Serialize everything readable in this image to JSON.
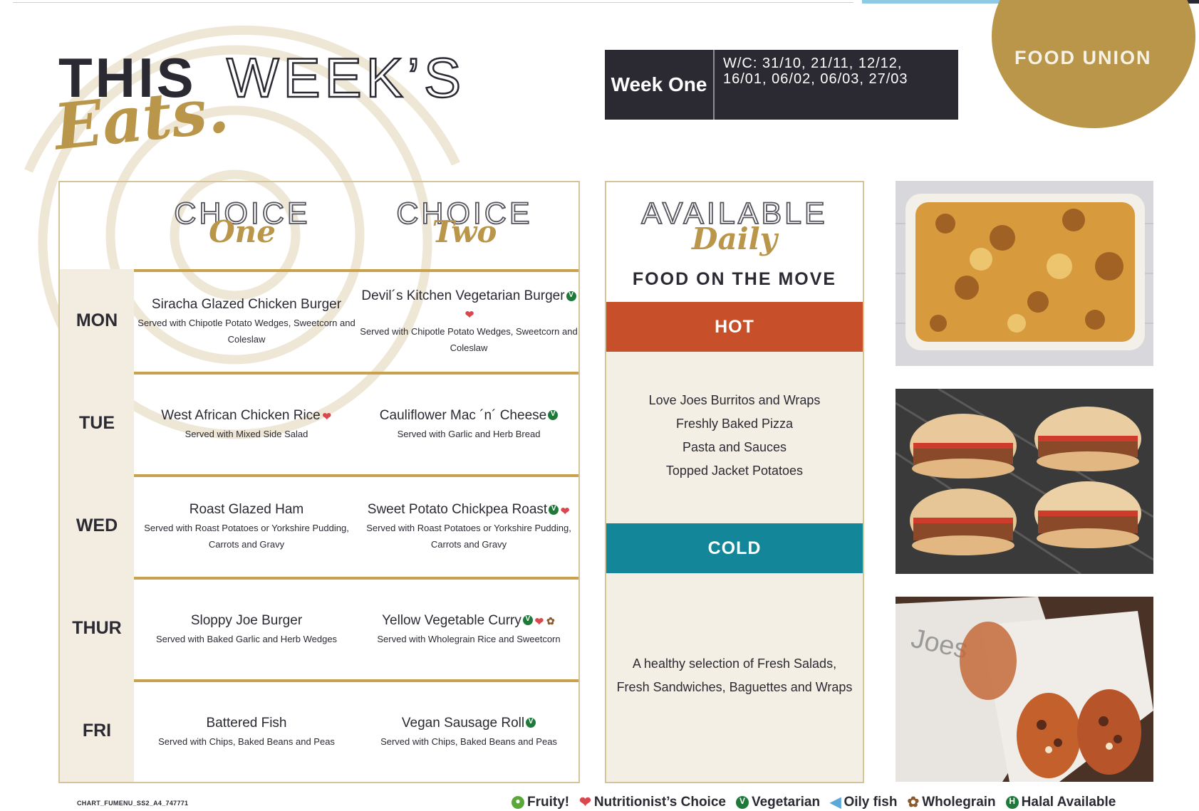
{
  "header": {
    "title_this": "THIS",
    "title_weeks": "WEEK’S",
    "title_eats": "Eats.",
    "week_label": "Week One",
    "week_dates": "W/C: 31/10, 21/11, 12/12, 16/01, 06/02, 06/03, 27/03",
    "brand": "FOOD UNION"
  },
  "menu": {
    "choice_one_word": "CHOICE",
    "choice_one_script": "One",
    "choice_two_word": "CHOICE",
    "choice_two_script": "Two",
    "rows": [
      {
        "day": "MON",
        "one": {
          "dish": "Siracha Glazed Chicken Burger",
          "side": "Served with Chipotle Potato Wedges, Sweetcorn and Coleslaw",
          "icons": []
        },
        "two": {
          "dish": "Devil´s Kitchen Vegetarian Burger",
          "side": "Served with Chipotle Potato Wedges, Sweetcorn and Coleslaw",
          "icons": [
            "vegetarian",
            "nutritionist"
          ]
        }
      },
      {
        "day": "TUE",
        "one": {
          "dish": "West African Chicken Rice",
          "side": "Served with Mixed Side Salad",
          "icons": [
            "nutritionist"
          ]
        },
        "two": {
          "dish": "Cauliflower Mac ´n´ Cheese",
          "side": "Served with Garlic and Herb Bread",
          "icons": [
            "vegetarian"
          ]
        }
      },
      {
        "day": "WED",
        "one": {
          "dish": "Roast Glazed Ham",
          "side": "Served with Roast Potatoes or Yorkshire Pudding, Carrots and Gravy",
          "icons": []
        },
        "two": {
          "dish": "Sweet Potato Chickpea Roast",
          "side": "Served with Roast Potatoes or Yorkshire Pudding, Carrots and Gravy",
          "icons": [
            "vegetarian",
            "nutritionist"
          ]
        }
      },
      {
        "day": "THUR",
        "one": {
          "dish": "Sloppy Joe Burger",
          "side": "Served with Baked Garlic and Herb Wedges",
          "icons": []
        },
        "two": {
          "dish": "Yellow Vegetable Curry",
          "side": "Served with Wholegrain Rice and Sweetcorn",
          "icons": [
            "vegetarian",
            "nutritionist",
            "wholegrain"
          ]
        }
      },
      {
        "day": "FRI",
        "one": {
          "dish": "Battered Fish",
          "side": "Served with Chips, Baked Beans and Peas",
          "icons": []
        },
        "two": {
          "dish": "Vegan Sausage Roll",
          "side": "Served with Chips, Baked Beans and Peas",
          "icons": [
            "vegetarian"
          ]
        }
      }
    ]
  },
  "available": {
    "word": "AVAILABLE",
    "script": "Daily",
    "subtitle": "FOOD ON THE MOVE",
    "hot_label": "HOT",
    "hot_items": [
      "Love Joes Burritos and Wraps",
      "Freshly Baked Pizza",
      "Pasta and Sauces",
      "Topped Jacket Potatoes"
    ],
    "cold_label": "COLD",
    "cold_line1": "A healthy selection of Fresh Salads,",
    "cold_line2": "Fresh Sandwiches, Baguettes and Wraps"
  },
  "photos": [
    {
      "name": "baked-pasta-tray-photo"
    },
    {
      "name": "sloppy-joe-burgers-photo"
    },
    {
      "name": "burrito-wraps-photo",
      "wrapper_text": "Joes"
    }
  ],
  "footer": {
    "code": "CHART_FUMENU_SS2_A4_747771",
    "legend": [
      {
        "label": "Fruity!",
        "icon": "apple-icon",
        "color": "#5aa83a"
      },
      {
        "label": "Nutritionist’s Choice",
        "icon": "heart-icon",
        "color": "#d9484e"
      },
      {
        "label": "Vegetarian",
        "icon": "v-icon",
        "color": "#1f7a3a"
      },
      {
        "label": "Oily fish",
        "icon": "fish-icon",
        "color": "#5aa9d8"
      },
      {
        "label": "Wholegrain",
        "icon": "wheat-icon",
        "color": "#8a5a2e"
      },
      {
        "label": "Halal Available",
        "icon": "h-icon",
        "color": "#1f7a3a"
      }
    ]
  },
  "colors": {
    "gold": "#b99649",
    "dark": "#2b2a33",
    "hot": "#c7502a",
    "cold": "#13869a",
    "cream": "#f4efe4"
  }
}
